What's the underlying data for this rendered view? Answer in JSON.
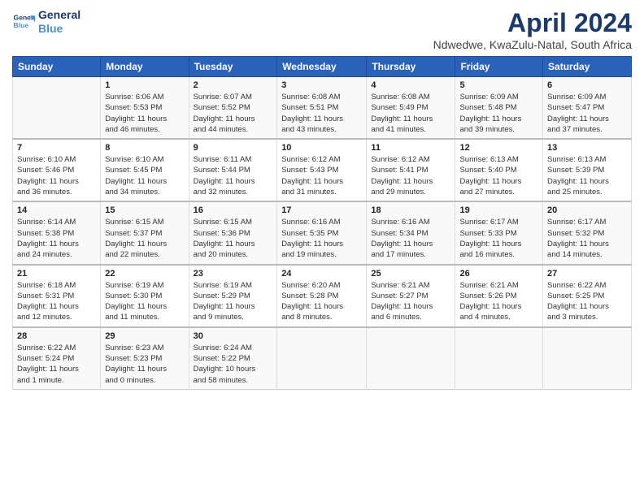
{
  "header": {
    "logo_line1": "General",
    "logo_line2": "Blue",
    "title": "April 2024",
    "subtitle": "Ndwedwe, KwaZulu-Natal, South Africa"
  },
  "days": [
    "Sunday",
    "Monday",
    "Tuesday",
    "Wednesday",
    "Thursday",
    "Friday",
    "Saturday"
  ],
  "weeks": [
    [
      {
        "date": "",
        "info": ""
      },
      {
        "date": "1",
        "info": "Sunrise: 6:06 AM\nSunset: 5:53 PM\nDaylight: 11 hours\nand 46 minutes."
      },
      {
        "date": "2",
        "info": "Sunrise: 6:07 AM\nSunset: 5:52 PM\nDaylight: 11 hours\nand 44 minutes."
      },
      {
        "date": "3",
        "info": "Sunrise: 6:08 AM\nSunset: 5:51 PM\nDaylight: 11 hours\nand 43 minutes."
      },
      {
        "date": "4",
        "info": "Sunrise: 6:08 AM\nSunset: 5:49 PM\nDaylight: 11 hours\nand 41 minutes."
      },
      {
        "date": "5",
        "info": "Sunrise: 6:09 AM\nSunset: 5:48 PM\nDaylight: 11 hours\nand 39 minutes."
      },
      {
        "date": "6",
        "info": "Sunrise: 6:09 AM\nSunset: 5:47 PM\nDaylight: 11 hours\nand 37 minutes."
      }
    ],
    [
      {
        "date": "7",
        "info": "Sunrise: 6:10 AM\nSunset: 5:46 PM\nDaylight: 11 hours\nand 36 minutes."
      },
      {
        "date": "8",
        "info": "Sunrise: 6:10 AM\nSunset: 5:45 PM\nDaylight: 11 hours\nand 34 minutes."
      },
      {
        "date": "9",
        "info": "Sunrise: 6:11 AM\nSunset: 5:44 PM\nDaylight: 11 hours\nand 32 minutes."
      },
      {
        "date": "10",
        "info": "Sunrise: 6:12 AM\nSunset: 5:43 PM\nDaylight: 11 hours\nand 31 minutes."
      },
      {
        "date": "11",
        "info": "Sunrise: 6:12 AM\nSunset: 5:41 PM\nDaylight: 11 hours\nand 29 minutes."
      },
      {
        "date": "12",
        "info": "Sunrise: 6:13 AM\nSunset: 5:40 PM\nDaylight: 11 hours\nand 27 minutes."
      },
      {
        "date": "13",
        "info": "Sunrise: 6:13 AM\nSunset: 5:39 PM\nDaylight: 11 hours\nand 25 minutes."
      }
    ],
    [
      {
        "date": "14",
        "info": "Sunrise: 6:14 AM\nSunset: 5:38 PM\nDaylight: 11 hours\nand 24 minutes."
      },
      {
        "date": "15",
        "info": "Sunrise: 6:15 AM\nSunset: 5:37 PM\nDaylight: 11 hours\nand 22 minutes."
      },
      {
        "date": "16",
        "info": "Sunrise: 6:15 AM\nSunset: 5:36 PM\nDaylight: 11 hours\nand 20 minutes."
      },
      {
        "date": "17",
        "info": "Sunrise: 6:16 AM\nSunset: 5:35 PM\nDaylight: 11 hours\nand 19 minutes."
      },
      {
        "date": "18",
        "info": "Sunrise: 6:16 AM\nSunset: 5:34 PM\nDaylight: 11 hours\nand 17 minutes."
      },
      {
        "date": "19",
        "info": "Sunrise: 6:17 AM\nSunset: 5:33 PM\nDaylight: 11 hours\nand 16 minutes."
      },
      {
        "date": "20",
        "info": "Sunrise: 6:17 AM\nSunset: 5:32 PM\nDaylight: 11 hours\nand 14 minutes."
      }
    ],
    [
      {
        "date": "21",
        "info": "Sunrise: 6:18 AM\nSunset: 5:31 PM\nDaylight: 11 hours\nand 12 minutes."
      },
      {
        "date": "22",
        "info": "Sunrise: 6:19 AM\nSunset: 5:30 PM\nDaylight: 11 hours\nand 11 minutes."
      },
      {
        "date": "23",
        "info": "Sunrise: 6:19 AM\nSunset: 5:29 PM\nDaylight: 11 hours\nand 9 minutes."
      },
      {
        "date": "24",
        "info": "Sunrise: 6:20 AM\nSunset: 5:28 PM\nDaylight: 11 hours\nand 8 minutes."
      },
      {
        "date": "25",
        "info": "Sunrise: 6:21 AM\nSunset: 5:27 PM\nDaylight: 11 hours\nand 6 minutes."
      },
      {
        "date": "26",
        "info": "Sunrise: 6:21 AM\nSunset: 5:26 PM\nDaylight: 11 hours\nand 4 minutes."
      },
      {
        "date": "27",
        "info": "Sunrise: 6:22 AM\nSunset: 5:25 PM\nDaylight: 11 hours\nand 3 minutes."
      }
    ],
    [
      {
        "date": "28",
        "info": "Sunrise: 6:22 AM\nSunset: 5:24 PM\nDaylight: 11 hours\nand 1 minute."
      },
      {
        "date": "29",
        "info": "Sunrise: 6:23 AM\nSunset: 5:23 PM\nDaylight: 11 hours\nand 0 minutes."
      },
      {
        "date": "30",
        "info": "Sunrise: 6:24 AM\nSunset: 5:22 PM\nDaylight: 10 hours\nand 58 minutes."
      },
      {
        "date": "",
        "info": ""
      },
      {
        "date": "",
        "info": ""
      },
      {
        "date": "",
        "info": ""
      },
      {
        "date": "",
        "info": ""
      }
    ]
  ]
}
